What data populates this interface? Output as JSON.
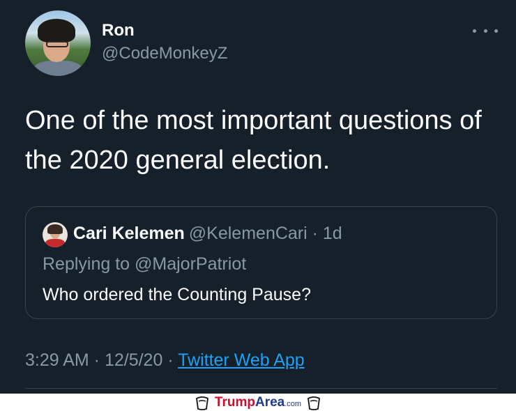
{
  "user": {
    "name": "Ron",
    "handle": "@CodeMonkeyZ"
  },
  "tweet": {
    "text": "One of the most important questions of the 2020 general election."
  },
  "quoted_tweet": {
    "name": "Cari Kelemen",
    "handle": "@KelemenCari",
    "separator": " · ",
    "time": "1d",
    "replying_to": "Replying to @MajorPatriot",
    "text": "Who ordered the Counting Pause?"
  },
  "meta": {
    "time": "3:29 AM",
    "date": "12/5/20",
    "separator": " · ",
    "source_app": "Twitter Web App"
  },
  "watermark": {
    "part1": "Trump",
    "part2": "Area",
    "part3": ".com"
  },
  "colors": {
    "background": "#15202b",
    "primary_text": "#ffffff",
    "secondary_text": "#8899a6",
    "link": "#1da1f2",
    "border": "#38444d"
  },
  "icons": {
    "more": "more-dots-icon"
  }
}
